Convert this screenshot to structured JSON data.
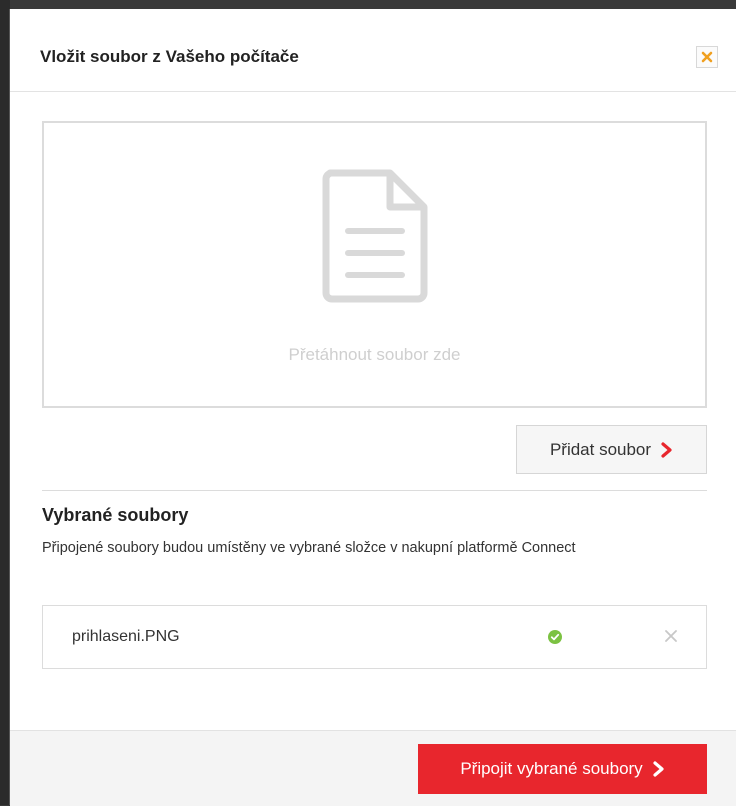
{
  "dialog": {
    "title": "Vložit soubor z Vašeho počítače"
  },
  "dropzone": {
    "text": "Přetáhnout soubor zde",
    "icon": "document-icon"
  },
  "add_button": {
    "label": "Přidat soubor",
    "icon": "chevron-right-icon"
  },
  "selected": {
    "heading": "Vybrané soubory",
    "description": "Připojené soubory budou umístěny ve vybrané složce v nakupní platformě Connect",
    "files": [
      {
        "name": "prihlaseni.PNG",
        "status_icon": "check-circle-icon",
        "remove_icon": "close-icon"
      }
    ]
  },
  "footer": {
    "attach_label": "Připojit vybrané soubory"
  },
  "colors": {
    "accent": "#e8262d",
    "close_icon": "#f0a020",
    "success": "#7cc242"
  }
}
